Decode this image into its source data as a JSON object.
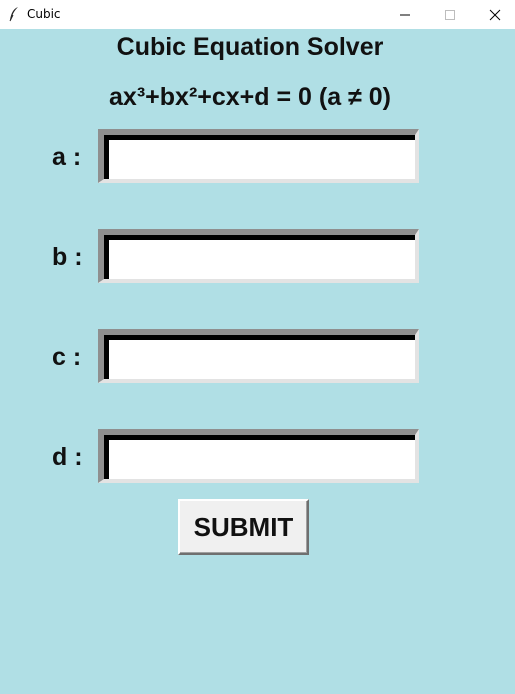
{
  "window": {
    "title": "Cubic",
    "icon": "feather-icon",
    "controls": [
      "minimize-icon",
      "maximize-icon",
      "close-icon"
    ]
  },
  "app": {
    "heading": "Cubic Equation Solver",
    "equation": "ax³+bx²+cx+d = 0 (a ≠ 0)"
  },
  "fields": [
    {
      "label": "a :",
      "value": ""
    },
    {
      "label": "b :",
      "value": ""
    },
    {
      "label": "c :",
      "value": ""
    },
    {
      "label": "d :",
      "value": ""
    }
  ],
  "submit_label": "SUBMIT",
  "colors": {
    "background": "#b0dfe5",
    "titlebar": "#ffffff",
    "button": "#f0f0f0"
  }
}
